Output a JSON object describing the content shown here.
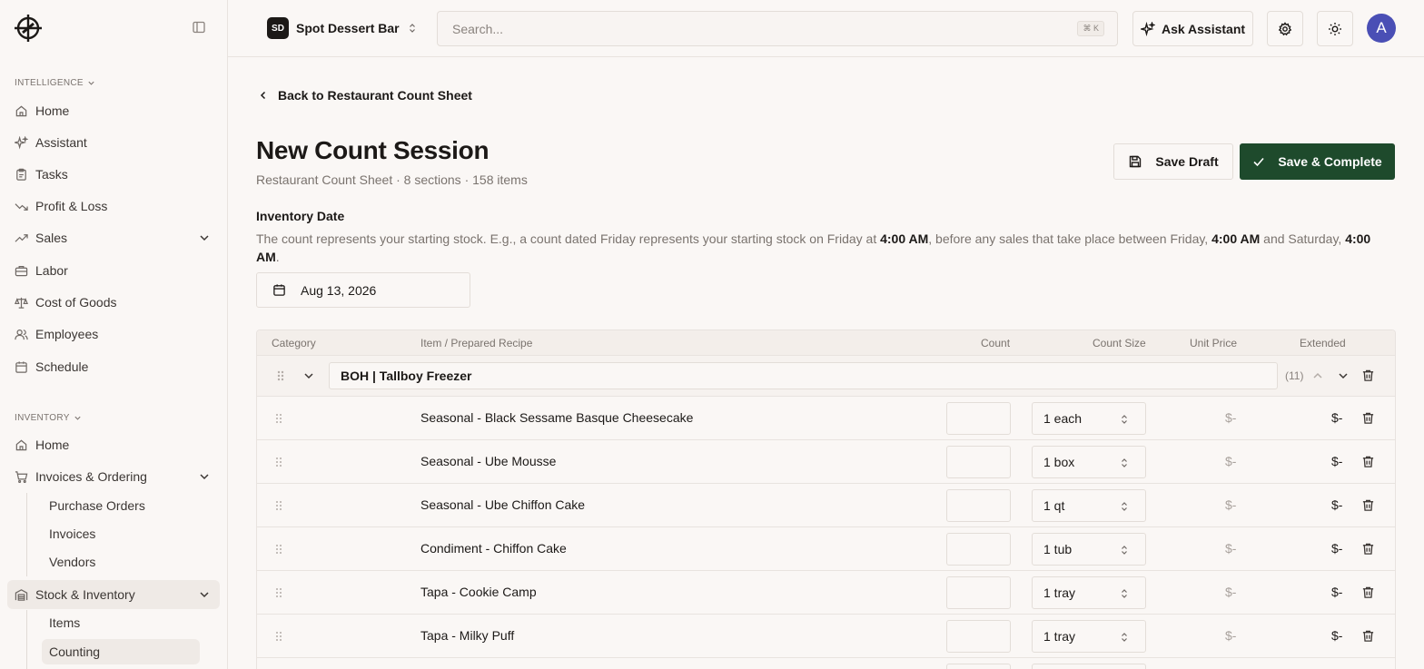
{
  "sidebar": {
    "intelligence_label": "INTELLIGENCE",
    "inventory_label": "INVENTORY",
    "intel_items": [
      {
        "label": "Home",
        "icon": "home-icon"
      },
      {
        "label": "Assistant",
        "icon": "sparkle-icon"
      },
      {
        "label": "Tasks",
        "icon": "clipboard-icon"
      },
      {
        "label": "Profit & Loss",
        "icon": "trend-down-icon"
      },
      {
        "label": "Sales",
        "icon": "trend-up-icon"
      },
      {
        "label": "Labor",
        "icon": "briefcase-icon"
      },
      {
        "label": "Cost of Goods",
        "icon": "scale-icon"
      },
      {
        "label": "Employees",
        "icon": "users-icon"
      },
      {
        "label": "Schedule",
        "icon": "calendar-icon"
      }
    ],
    "inv_items": [
      {
        "label": "Home",
        "icon": "home-icon"
      },
      {
        "label": "Invoices & Ordering",
        "icon": "cart-icon"
      },
      {
        "label": "Stock & Inventory",
        "icon": "warehouse-icon"
      }
    ],
    "invoice_sub": [
      "Purchase Orders",
      "Invoices",
      "Vendors"
    ],
    "stock_sub": [
      "Items",
      "Counting"
    ]
  },
  "topbar": {
    "org_initials": "SD",
    "org_name": "Spot Dessert Bar",
    "search_placeholder": "Search...",
    "search_shortcut": "⌘ K",
    "ask_label": "Ask Assistant",
    "avatar_initial": "A"
  },
  "main": {
    "back_label": "Back to Restaurant Count Sheet",
    "title": "New Count Session",
    "subtitle": "Restaurant Count Sheet · 8 sections · 158 items",
    "save_draft_label": "Save Draft",
    "save_complete_label": "Save & Complete",
    "inventory_date_label": "Inventory Date",
    "desc": {
      "p1": "The count represents your starting stock. E.g., a count dated Friday represents your starting stock on Friday at ",
      "t1": "4:00 AM",
      "p2": ", before any sales that take place between Friday, ",
      "t2": "4:00 AM",
      "p3": " and Saturday, ",
      "t3": "4:00 AM",
      "p4": "."
    },
    "date_value": "Aug 13, 2026"
  },
  "table": {
    "headers": {
      "category": "Category",
      "item": "Item / Prepared Recipe",
      "count": "Count",
      "count_size": "Count Size",
      "unit_price": "Unit Price",
      "extended": "Extended"
    },
    "group": {
      "name": "BOH | Tallboy Freezer",
      "count": "(11)"
    },
    "rows": [
      {
        "name": "Seasonal - Black Sessame Basque Cheesecake",
        "size": "1 each",
        "unit_price": "$-",
        "extended": "$-"
      },
      {
        "name": "Seasonal - Ube Mousse",
        "size": "1 box",
        "unit_price": "$-",
        "extended": "$-"
      },
      {
        "name": "Seasonal - Ube Chiffon Cake",
        "size": "1 qt",
        "unit_price": "$-",
        "extended": "$-"
      },
      {
        "name": "Condiment - Chiffon Cake",
        "size": "1 tub",
        "unit_price": "$-",
        "extended": "$-"
      },
      {
        "name": "Tapa - Cookie Camp",
        "size": "1 tray",
        "unit_price": "$-",
        "extended": "$-"
      },
      {
        "name": "Tapa - Milky Puff",
        "size": "1 tray",
        "unit_price": "$-",
        "extended": "$-"
      }
    ]
  },
  "colors": {
    "primary_button": "#1e4a2c",
    "avatar": "#4a4fb5",
    "background": "#faf7f5"
  }
}
